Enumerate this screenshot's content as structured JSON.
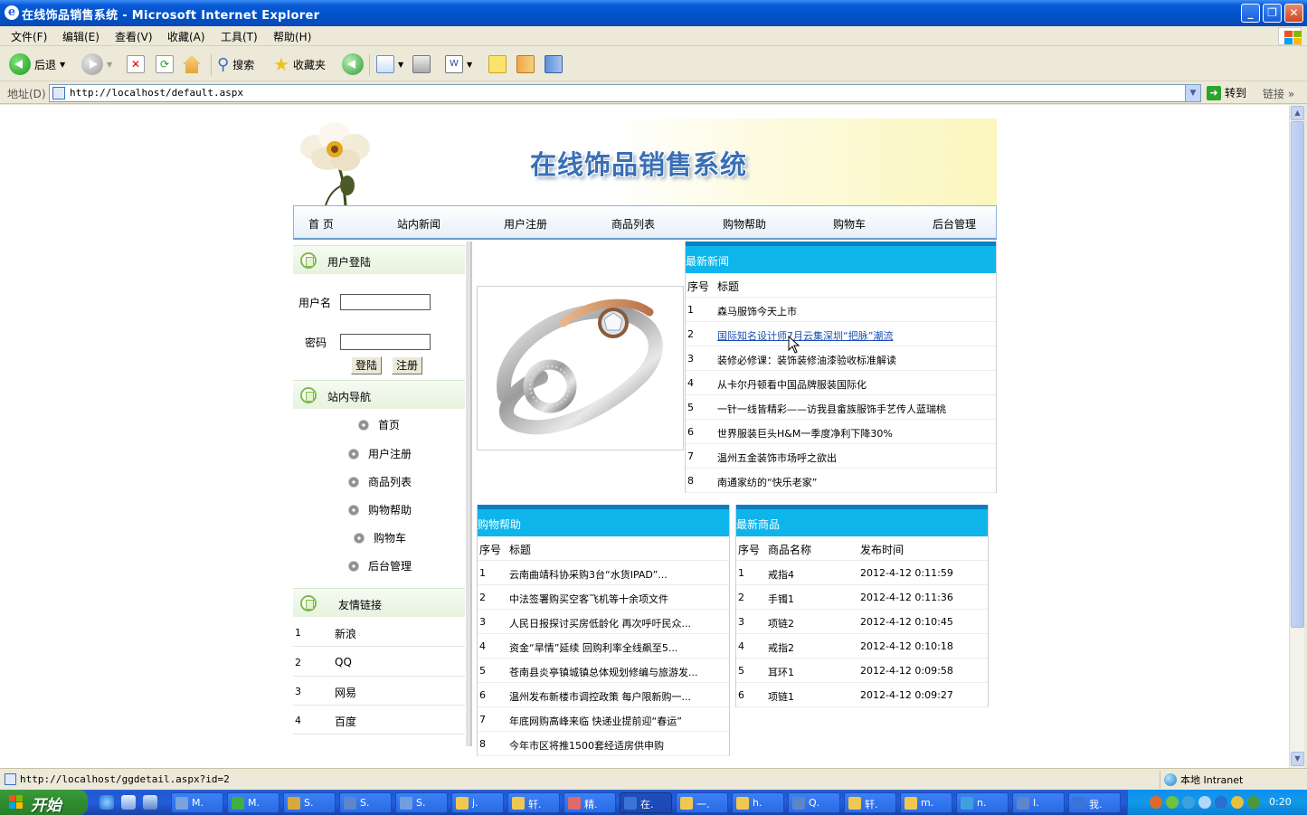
{
  "window": {
    "title": "在线饰品销售系统 - Microsoft Internet Explorer"
  },
  "menubar": [
    "文件(F)",
    "编辑(E)",
    "查看(V)",
    "收藏(A)",
    "工具(T)",
    "帮助(H)"
  ],
  "toolbar": {
    "back": "后退",
    "search": "搜索",
    "favorites": "收藏夹"
  },
  "address": {
    "label": "地址(D)",
    "url": "http://localhost/default.aspx",
    "go": "转到",
    "links": "链接"
  },
  "site": {
    "title": "在线饰品销售系统",
    "nav": [
      "首 页",
      "站内新闻",
      "用户注册",
      "商品列表",
      "购物帮助",
      "购物车",
      "后台管理"
    ]
  },
  "login": {
    "heading": "用户登陆",
    "username_label": "用户名",
    "username_value": "",
    "password_label": "密码",
    "password_value": "",
    "login_button": "登陆",
    "register_button": "注册"
  },
  "site_nav": {
    "heading": "站内导航",
    "items": [
      "首页",
      "用户注册",
      "商品列表",
      "购物帮助",
      "购物车",
      "后台管理"
    ]
  },
  "friend_links": {
    "heading": "友情链接",
    "items": [
      {
        "num": "1",
        "name": "新浪"
      },
      {
        "num": "2",
        "name": "QQ"
      },
      {
        "num": "3",
        "name": "网易"
      },
      {
        "num": "4",
        "name": "百度"
      }
    ]
  },
  "latest_news": {
    "heading": "最新新闻",
    "columns": [
      "序号",
      "标题"
    ],
    "rows": [
      {
        "num": "1",
        "title": "森马服饰今天上市"
      },
      {
        "num": "2",
        "title": "国际知名设计师7月云集深圳“把脉”潮流"
      },
      {
        "num": "3",
        "title": "装修必修课：装饰装修油漆验收标准解读"
      },
      {
        "num": "4",
        "title": "从卡尔丹顿看中国品牌服装国际化"
      },
      {
        "num": "5",
        "title": "一针一线皆精彩——访我县畲族服饰手艺传人蓝瑞桃"
      },
      {
        "num": "6",
        "title": "世界服装巨头H&M一季度净利下降30%"
      },
      {
        "num": "7",
        "title": "温州五金装饰市场呼之欲出"
      },
      {
        "num": "8",
        "title": "南通家纺的“快乐老家”"
      }
    ]
  },
  "shopping_help": {
    "heading": "购物帮助",
    "columns": [
      "序号",
      "标题"
    ],
    "rows": [
      {
        "num": "1",
        "title": "云南曲靖科协采购3台“水货IPAD”..."
      },
      {
        "num": "2",
        "title": "中法签署购买空客飞机等十余项文件"
      },
      {
        "num": "3",
        "title": "人民日报探讨买房低龄化 再次呼吁民众..."
      },
      {
        "num": "4",
        "title": "资金“旱情”延续 回购利率全线飙至5..."
      },
      {
        "num": "5",
        "title": "苍南县炎亭镇城镇总体规划修编与旅游发..."
      },
      {
        "num": "6",
        "title": "温州发布新楼市调控政策 每户限新购一..."
      },
      {
        "num": "7",
        "title": "年底网购高峰来临 快递业提前迎“春运”"
      },
      {
        "num": "8",
        "title": "今年市区将推1500套经适房供申购"
      }
    ]
  },
  "latest_products": {
    "heading": "最新商品",
    "columns": [
      "序号",
      "商品名称",
      "发布时间"
    ],
    "rows": [
      {
        "num": "1",
        "name": "戒指4",
        "time": "2012-4-12 0:11:59"
      },
      {
        "num": "2",
        "name": "手镯1",
        "time": "2012-4-12 0:11:36"
      },
      {
        "num": "3",
        "name": "项链2",
        "time": "2012-4-12 0:10:45"
      },
      {
        "num": "4",
        "name": "戒指2",
        "time": "2012-4-12 0:10:18"
      },
      {
        "num": "5",
        "name": "耳环1",
        "time": "2012-4-12 0:09:58"
      },
      {
        "num": "6",
        "name": "项链1",
        "time": "2012-4-12 0:09:27"
      }
    ]
  },
  "status": {
    "text": "http://localhost/ggdetail.aspx?id=2",
    "zone": "本地 Intranet"
  },
  "taskbar": {
    "start": "开始",
    "tasks": [
      "M.",
      "M.",
      "S.",
      "S.",
      "S.",
      "j.",
      "轩.",
      "精.",
      "在.",
      "一.",
      "h.",
      "Q.",
      "轩.",
      "m.",
      "n.",
      "I.",
      "我."
    ],
    "clock": "0:20"
  }
}
